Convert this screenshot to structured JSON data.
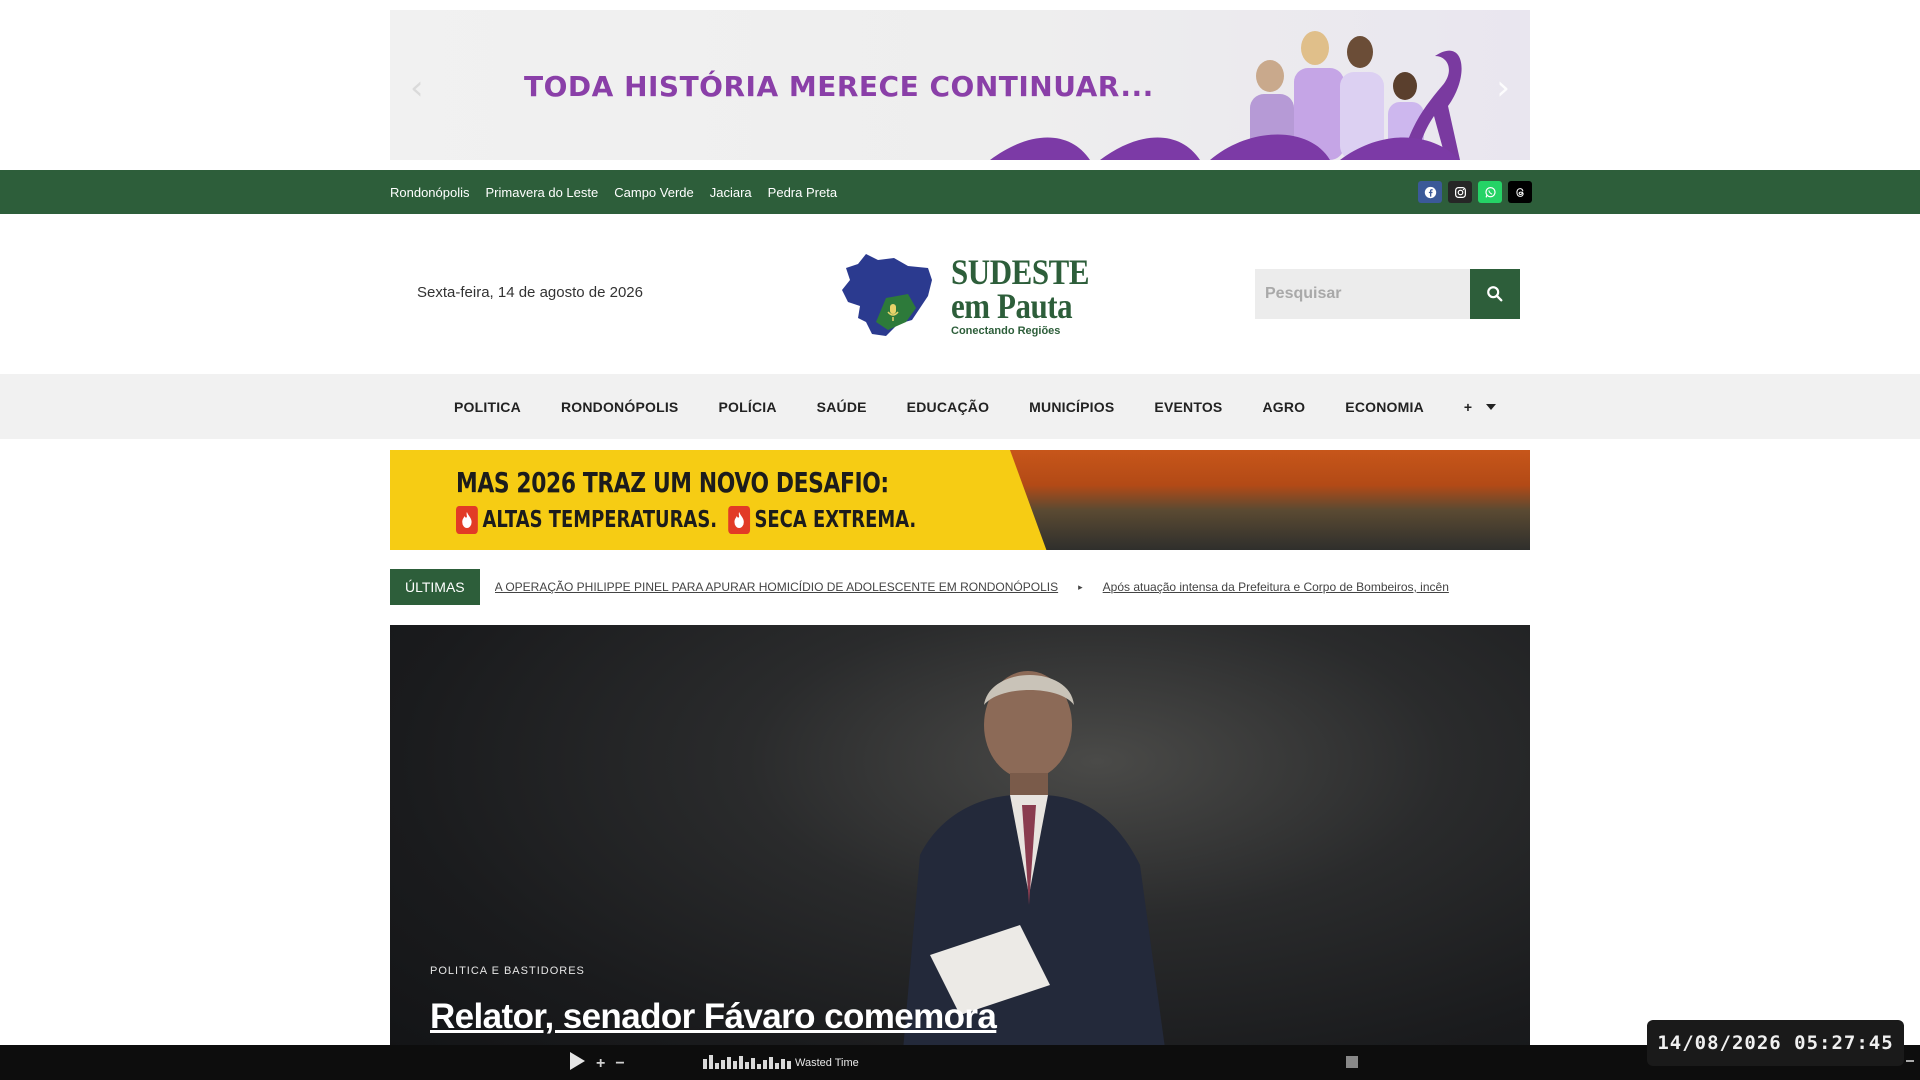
{
  "top_banner": {
    "headline": "TODA HISTÓRIA MERECE CONTINUAR..."
  },
  "city_bar": {
    "cities": [
      "Rondonópolis",
      "Primavera do Leste",
      "Campo Verde",
      "Jaciara",
      "Pedra Preta"
    ],
    "socials": [
      {
        "icon": "facebook-icon",
        "color": "#3b5998"
      },
      {
        "icon": "instagram-icon",
        "color": "#262626"
      },
      {
        "icon": "whatsapp-icon",
        "color": "#25d366"
      },
      {
        "icon": "threads-icon",
        "color": "#000000"
      }
    ]
  },
  "header": {
    "date": "Sexta-feira, 14 de agosto de 2026",
    "logo": {
      "line1": "SUDESTE",
      "line2": "em Pauta",
      "tagline": "Conectando Regiões"
    },
    "search": {
      "placeholder": "Pesquisar"
    }
  },
  "nav": {
    "items": [
      "POLITICA",
      "RONDONÓPOLIS",
      "POLÍCIA",
      "SAÚDE",
      "EDUCAÇÃO",
      "MUNICÍPIOS",
      "EVENTOS",
      "AGRO",
      "ECONOMIA"
    ],
    "more_label": "+"
  },
  "mid_banner": {
    "line1": "MAS 2026 TRAZ UM NOVO DESAFIO:",
    "line2a": "ALTAS TEMPERATURAS.",
    "line2b": "SECA EXTREMA."
  },
  "ticker": {
    "label": "ÚLTIMAS",
    "items": [
      "A OPERAÇÃO PHILIPPE PINEL PARA APURAR HOMICÍDIO DE ADOLESCENTE EM RONDONÓPOLIS",
      "Após atuação intensa da Prefeitura e Corpo de Bombeiros, incên"
    ]
  },
  "hero": {
    "category": "POLITICA E BASTIDORES",
    "title": "Relator, senador Fávaro comemora"
  },
  "player": {
    "track": "Wasted Time"
  },
  "clock": "14/08/2026 05:27:45",
  "colors": {
    "brand_green": "#2d5e3a",
    "banner_purple": "#8a3fa8",
    "banner_yellow": "#f6cc14"
  }
}
